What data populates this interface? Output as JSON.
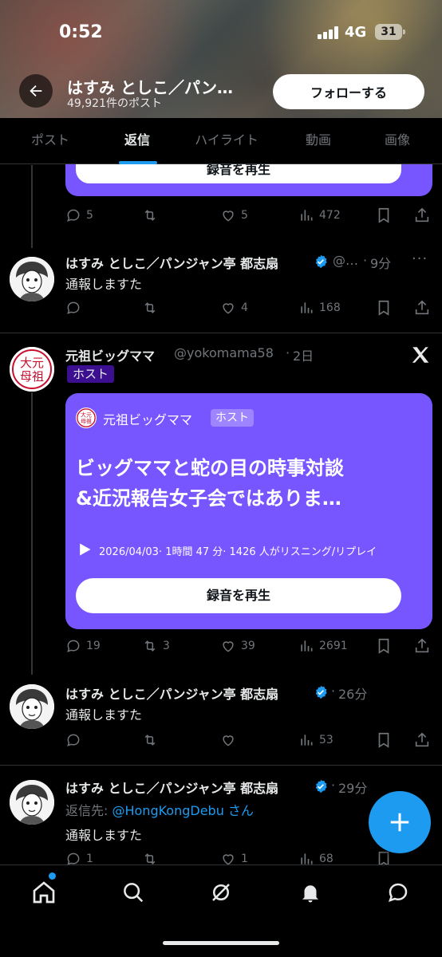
{
  "status_bar": {
    "time": "0:52",
    "network": "4G",
    "battery": "31"
  },
  "header": {
    "profile_name": "はすみ としこ／パン…",
    "post_count": "49,921件のポスト",
    "follow_label": "フォローする"
  },
  "tabs": [
    {
      "label": "ポスト",
      "active": false
    },
    {
      "label": "返信",
      "active": true
    },
    {
      "label": "ハイライト",
      "active": false
    },
    {
      "label": "動画",
      "active": false
    },
    {
      "label": "画像",
      "active": false
    }
  ],
  "top_card": {
    "button_label": "録音を再生"
  },
  "posts": [
    {
      "replies": "5",
      "retweets": "",
      "likes": "5",
      "views": "472"
    },
    {
      "name": "はすみ としこ／パンジャン亭 都志扇",
      "handle": "@…",
      "time": "9分",
      "text": "通報しますた",
      "replies": "",
      "retweets": "",
      "likes": "4",
      "views": "168"
    },
    {
      "name": "元祖ビッグママ",
      "handle": "@yokomama58",
      "time": "2日",
      "badge": "ホスト",
      "card": {
        "host_name": "元祖ビッグママ",
        "host_badge": "ホスト",
        "title_line1": "ビッグママと蛇の目の時事対談",
        "title_line2": "&近況報告女子会ではありま…",
        "meta": "2026/04/03· 1時間 47 分· 1426 人がリスニング/リプレイ",
        "button_label": "録音を再生"
      },
      "replies": "19",
      "retweets": "3",
      "likes": "39",
      "views": "2691"
    },
    {
      "name": "はすみ としこ／パンジャン亭 都志扇",
      "time": "26分",
      "text": "通報しますた",
      "replies": "",
      "retweets": "",
      "likes": "",
      "views": "53"
    },
    {
      "name": "はすみ としこ／パンジャン亭 都志扇",
      "time": "29分",
      "reply_prefix": "返信先: ",
      "reply_handle": "@HongKongDebu",
      "reply_suffix": " さん",
      "text": "通報しますた",
      "replies": "1",
      "retweets": "",
      "likes": "1",
      "views": "68"
    }
  ],
  "avatar_seal_text": "元祖大母",
  "icons": {
    "back": "arrow-left-icon",
    "fab": "plus-icon",
    "nav": [
      "home-icon",
      "search-icon",
      "grok-icon",
      "bell-icon",
      "mail-icon"
    ]
  },
  "colors": {
    "accent": "#1d9bf0",
    "space_card": "#7856ff",
    "muted": "#71767b"
  }
}
